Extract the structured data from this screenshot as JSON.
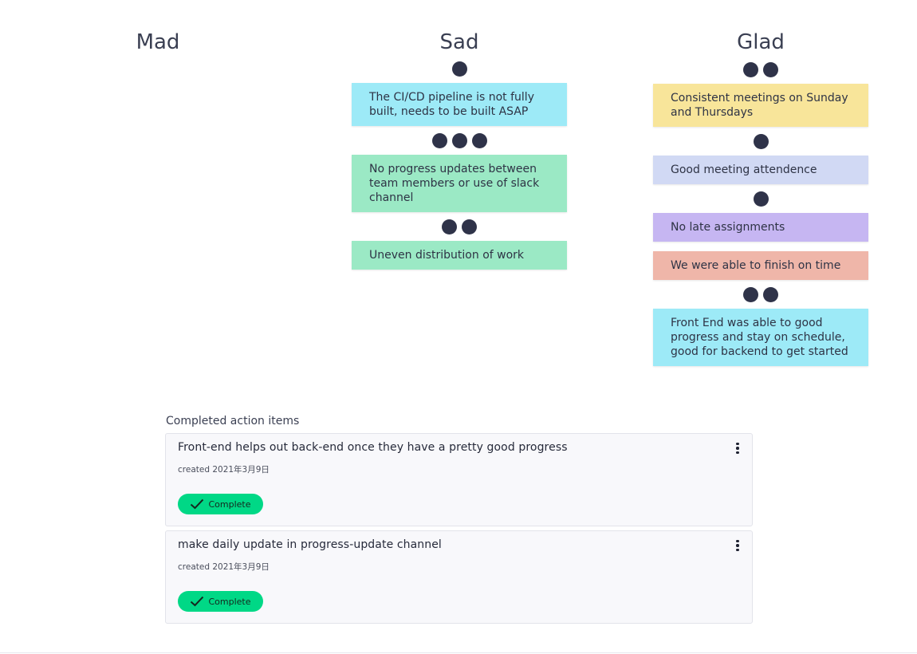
{
  "columns": [
    {
      "title": "Mad",
      "items": []
    },
    {
      "title": "Sad",
      "items": [
        {
          "text": "The CI/CD pipeline is not fully built, needs to be built ASAP",
          "votes": 1,
          "color": "#9deaf7"
        },
        {
          "text": "No progress updates between team members or use of slack channel",
          "votes": 3,
          "color": "#9be9c5"
        },
        {
          "text": "Uneven distribution of work",
          "votes": 2,
          "color": "#9be9c5"
        }
      ]
    },
    {
      "title": "Glad",
      "items": [
        {
          "text": "Consistent meetings on Sunday and Thursdays",
          "votes": 2,
          "color": "#f8e59a"
        },
        {
          "text": "Good meeting attendence",
          "votes": 1,
          "color": "#d1d9f4"
        },
        {
          "text": "No late assignments",
          "votes": 1,
          "color": "#c6b6f2"
        },
        {
          "text": "We were able to finish on time",
          "votes": 0,
          "color": "#efb6a9"
        },
        {
          "text": "Front End was able to good progress and stay on schedule, good for backend to get started",
          "votes": 2,
          "color": "#9deaf7"
        }
      ]
    }
  ],
  "action_items": {
    "label": "Completed action items",
    "items": [
      {
        "title": "Front-end helps out back-end once they have a pretty good progress",
        "date": "created 2021年3月9日",
        "status_label": "Complete"
      },
      {
        "title": "make daily update in progress-update channel",
        "date": "created 2021年3月9日",
        "status_label": "Complete"
      }
    ]
  },
  "colors": {
    "dot": "#2f3349",
    "complete": "#00d886"
  }
}
